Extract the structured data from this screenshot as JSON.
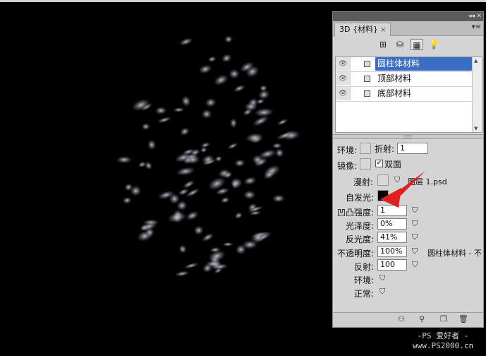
{
  "panel": {
    "tab_label": "3D {材料}",
    "tab_close": "×",
    "toolbar": [
      {
        "name": "scene-filter-icon",
        "glyph": "⊞"
      },
      {
        "name": "mesh-filter-icon",
        "glyph": "⛁"
      },
      {
        "name": "material-filter-icon",
        "glyph": "▦"
      },
      {
        "name": "light-filter-icon",
        "glyph": "💡"
      }
    ],
    "materials": [
      {
        "label": "圆柱体材料",
        "selected": true
      },
      {
        "label": "顶部材料",
        "selected": false
      },
      {
        "label": "底部材料",
        "selected": false
      }
    ],
    "props": {
      "environment_label": "环境:",
      "refraction_label": "折射:",
      "refraction_value": "1",
      "reflection_mirror_label": "镜像:",
      "double_sided_label": "双面",
      "diffuse_label": "漫射:",
      "diffuse_texture": "图层 1.psd",
      "self_illum_label": "自发光:",
      "bump_label": "凹凸强度:",
      "bump_value": "1",
      "gloss_label": "光泽度:",
      "gloss_value": "0%",
      "shine_label": "反光度:",
      "shine_value": "41%",
      "opacity_label": "不透明度:",
      "opacity_value": "100%",
      "opacity_texture": "圆柱体材料 - 不",
      "reflection_label": "反射:",
      "reflection_value": "100",
      "env_label": "环境:",
      "normal_label": "正常:"
    }
  },
  "watermark": {
    "line1": "-PS 爱好者 -",
    "line2": "www.PS2000.cn"
  },
  "colors": {
    "selection": "#3a6ec5",
    "panel_bg": "#d4d4d4",
    "arrow": "#e0201f"
  }
}
